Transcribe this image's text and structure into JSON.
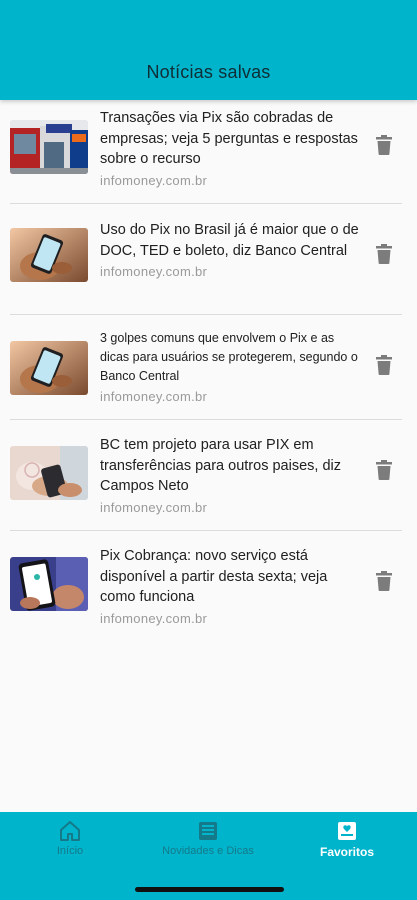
{
  "header": {
    "title": "Notícias salvas"
  },
  "colors": {
    "accent": "#00b4cc",
    "inactive_nav": "#147a8a",
    "trash": "#7c7c7c"
  },
  "items": [
    {
      "title": "Transações via Pix são cobradas de empresas; veja 5 perguntas e respostas sobre o recurso",
      "source": "infomoney.com.br",
      "thumb": "bank-storefront-image"
    },
    {
      "title": "Uso do Pix no Brasil já é maior que o de DOC, TED e boleto, diz Banco Central",
      "source": "infomoney.com.br",
      "thumb": "hand-holding-phone-image"
    },
    {
      "title": "3 golpes comuns que envolvem o Pix e as dicas para usuários se protegerem, segundo o Banco Central",
      "source": "infomoney.com.br",
      "thumb": "hand-holding-phone-image"
    },
    {
      "title": "BC tem projeto para usar PIX em transferências para outros paises, diz Campos Neto",
      "source": "infomoney.com.br",
      "thumb": "hands-with-phone-image"
    },
    {
      "title": "Pix Cobrança: novo serviço está disponível a partir desta sexta; veja como funciona",
      "source": "infomoney.com.br",
      "thumb": "phone-pix-screen-image"
    }
  ],
  "nav": [
    {
      "label": "Início",
      "icon": "home-icon",
      "active": false
    },
    {
      "label": "Novidades e Dicas",
      "icon": "news-icon",
      "active": false
    },
    {
      "label": "Favoritos",
      "icon": "bookmark-icon",
      "active": true
    }
  ]
}
